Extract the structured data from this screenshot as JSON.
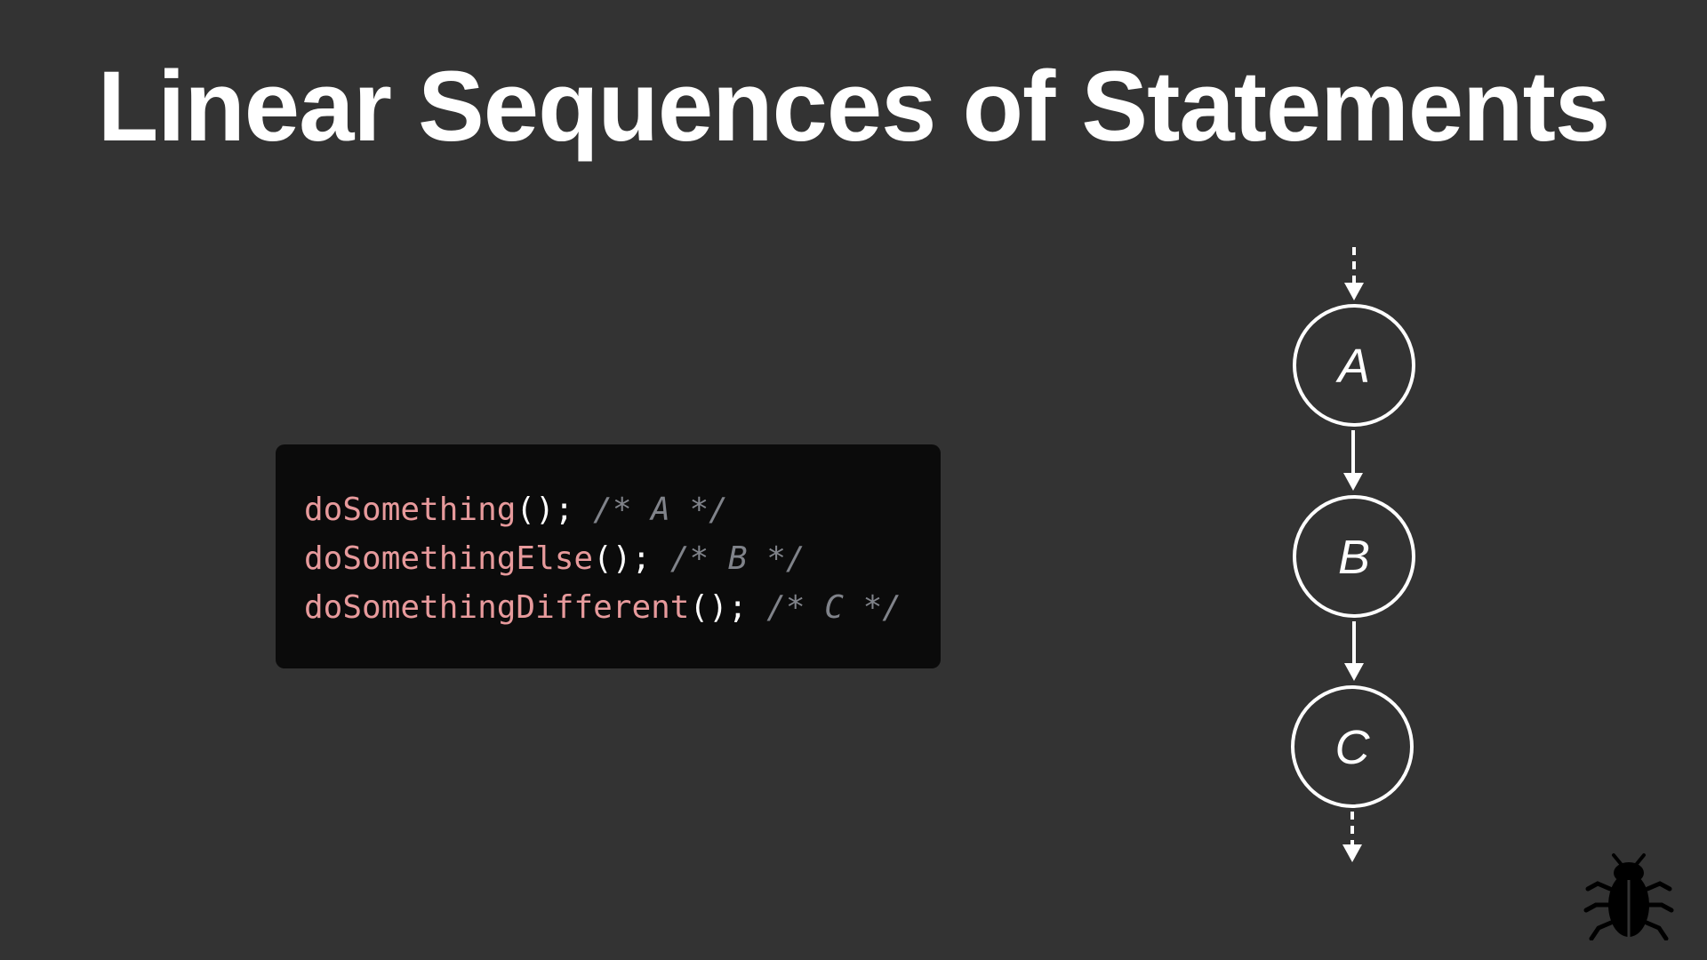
{
  "slide": {
    "title": "Linear Sequences of Statements"
  },
  "code": {
    "lines": [
      {
        "function": "doSomething",
        "punctuation": "();",
        "comment": "/* A */"
      },
      {
        "function": "doSomethingElse",
        "punctuation": "();",
        "comment": "/* B */"
      },
      {
        "function": "doSomethingDifferent",
        "punctuation": "();",
        "comment": "/* C */"
      }
    ],
    "colors": {
      "function": "#e79a9c",
      "punctuation": "#ffffff",
      "comment": "#80838a",
      "background": "#0b0b0b"
    }
  },
  "diagram": {
    "nodes": [
      "A",
      "B",
      "C"
    ],
    "incoming_edge": "dashed",
    "outgoing_edge": "dashed",
    "stroke_color": "#ffffff"
  },
  "footer": {
    "icon": "bug-icon"
  }
}
